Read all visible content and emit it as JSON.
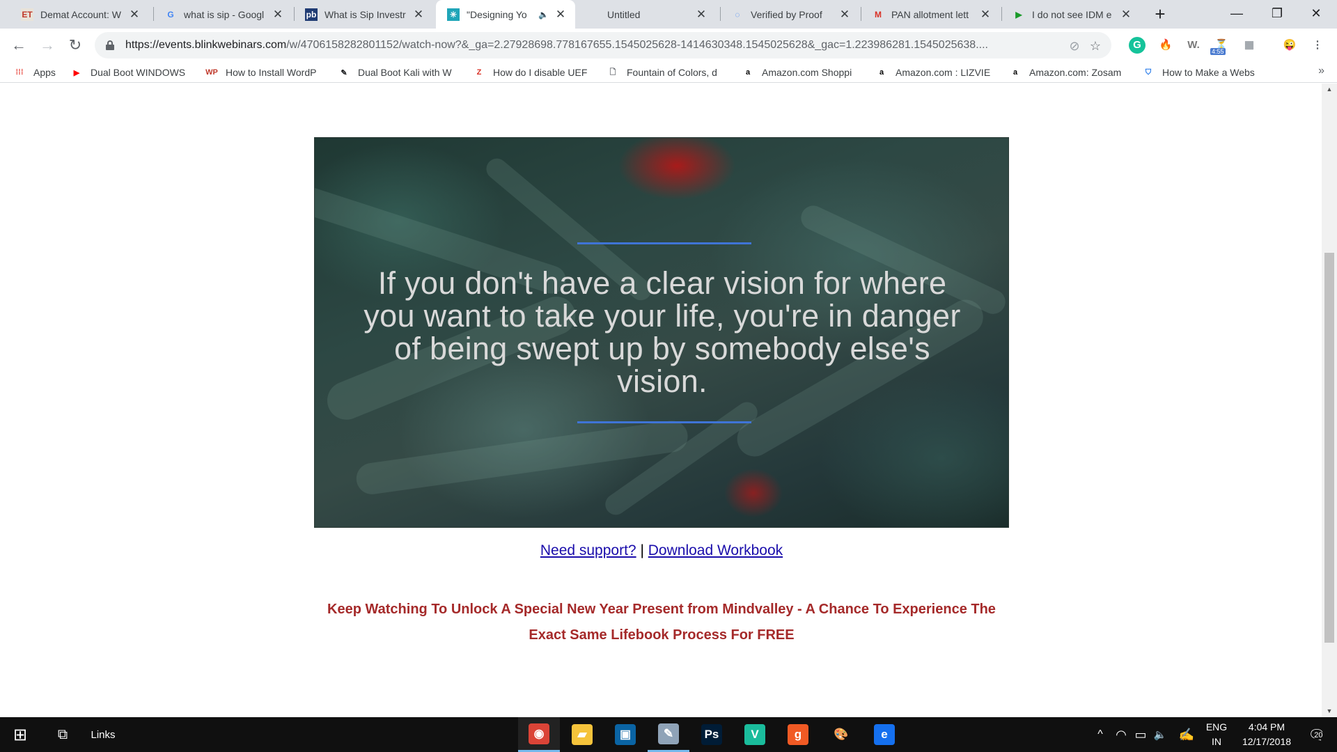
{
  "browser": {
    "tabs": [
      {
        "title": "Demat Account: W",
        "favicon": "ET",
        "favicon_color": "#c0392b",
        "favicon_bg": "#e8e3d9",
        "icon": "et-favicon-icon"
      },
      {
        "title": "what is sip - Googl",
        "favicon": "G",
        "favicon_color": "#4285f4",
        "favicon_bg": "transparent",
        "icon": "google-favicon-icon"
      },
      {
        "title": "What is Sip Investr",
        "favicon": "pb",
        "favicon_color": "#ffffff",
        "favicon_bg": "#1f3b73",
        "icon": "pb-favicon-icon"
      },
      {
        "title": "\"Designing Yo",
        "favicon": "✳",
        "favicon_color": "#ffffff",
        "favicon_bg": "#1fa5b8",
        "icon": "blinkwebinars-favicon-icon",
        "active": true,
        "audio": true
      },
      {
        "title": "Untitled",
        "favicon": "",
        "favicon_color": "#5f6368",
        "favicon_bg": "transparent",
        "icon": "blank-favicon-icon"
      },
      {
        "title": "Verified by Proof",
        "favicon": "◌",
        "favicon_color": "#3b82f6",
        "favicon_bg": "transparent",
        "icon": "proof-favicon-icon"
      },
      {
        "title": "PAN allotment lett",
        "favicon": "M",
        "favicon_color": "#d93025",
        "favicon_bg": "transparent",
        "icon": "gmail-favicon-icon"
      },
      {
        "title": "I do not see IDM e",
        "favicon": "▶",
        "favicon_color": "#1a9a2a",
        "favicon_bg": "transparent",
        "icon": "idm-favicon-icon"
      }
    ],
    "new_tab": "+",
    "window_controls": {
      "minimize": "—",
      "restore": "❐",
      "close": "✕"
    },
    "nav": {
      "back": "←",
      "forward": "→",
      "reload": "↻"
    },
    "url": {
      "host": "https://events.blinkwebinars.com",
      "rest": "/w/4706158282801152/watch-now?&_ga=2.27928698.778167655.1545025628-1414630348.1545025628&_gac=1.223986281.1545025638...."
    },
    "omnibox_icons": {
      "blocked": "⊘",
      "star": "☆"
    },
    "extensions": [
      {
        "glyph": "G",
        "color": "#ffffff",
        "bg": "#15c39a",
        "name": "grammarly-extension-icon"
      },
      {
        "glyph": "🔥",
        "color": "#ff6d00",
        "bg": "transparent",
        "name": "fire-extension-icon"
      },
      {
        "glyph": "W.",
        "color": "#7a7a7a",
        "bg": "transparent",
        "name": "w-extension-icon"
      },
      {
        "glyph": "⏳",
        "color": "#5f6368",
        "bg": "transparent",
        "name": "timer-extension-icon",
        "badge": "4:55"
      },
      {
        "glyph": "▦",
        "color": "#9aa0a6",
        "bg": "transparent",
        "name": "translate-extension-icon"
      },
      {
        "glyph": "😜",
        "color": "#f5b400",
        "bg": "transparent",
        "name": "profile-avatar-icon"
      },
      {
        "glyph": "⋮",
        "color": "#5f6368",
        "bg": "transparent",
        "name": "menu-kebab-icon"
      }
    ],
    "bookmarks": [
      {
        "label": "Apps",
        "icon": "apps-grid-icon",
        "glyph": "⁞⁞⁞",
        "color": "#e8453c"
      },
      {
        "label": "Dual Boot WINDOWS",
        "icon": "youtube-icon",
        "glyph": "▶",
        "color": "#ff0000"
      },
      {
        "label": "How to Install WordP",
        "icon": "wp-icon",
        "glyph": "WP",
        "color": "#c0392b"
      },
      {
        "label": "Dual Boot Kali with W",
        "icon": "kali-icon",
        "glyph": "✎",
        "color": "#202124"
      },
      {
        "label": "How do I disable UEF",
        "icon": "avast-icon",
        "glyph": "Z",
        "color": "#d93025"
      },
      {
        "label": "Fountain of Colors, d",
        "icon": "page-icon",
        "glyph": "🗋",
        "color": "#5f6368"
      },
      {
        "label": "Amazon.com Shoppi",
        "icon": "amazon-icon",
        "glyph": "a",
        "color": "#000000"
      },
      {
        "label": "Amazon.com : LIZVIE",
        "icon": "amazon-icon",
        "glyph": "a",
        "color": "#000000"
      },
      {
        "label": "Amazon.com: Zosam",
        "icon": "amazon-icon",
        "glyph": "a",
        "color": "#000000"
      },
      {
        "label": "How to Make a Webs",
        "icon": "shield-icon",
        "glyph": "⛉",
        "color": "#1a73e8"
      }
    ],
    "bookmarks_more": "»"
  },
  "page": {
    "video_quote": "If you don't have a clear vision for where you want to take your life, you're in danger of being swept up by somebody else's vision.",
    "support_link": "Need support?",
    "separator": "|",
    "workbook_link": "Download Workbook",
    "promo_text": "Keep Watching To Unlock A Special New Year Present from Mindvalley - A Chance To Experience The Exact Same Lifebook Process For FREE"
  },
  "taskbar": {
    "start": "⊞",
    "task_view": "⧉",
    "links_label": "Links",
    "apps": [
      {
        "name": "chrome-app-icon",
        "glyph": "◉",
        "bg": "#db4437",
        "state": "active"
      },
      {
        "name": "file-explorer-app-icon",
        "glyph": "▰",
        "bg": "#f5c33b",
        "state": ""
      },
      {
        "name": "outlook-app-icon",
        "glyph": "▣",
        "bg": "#0a64a4",
        "state": ""
      },
      {
        "name": "notepad-app-icon",
        "glyph": "✎",
        "bg": "#8fa3b8",
        "state": "open"
      },
      {
        "name": "photoshop-app-icon",
        "glyph": "Ps",
        "bg": "#001c36",
        "state": ""
      },
      {
        "name": "vectr-app-icon",
        "glyph": "V",
        "bg": "#1abc9c",
        "state": ""
      },
      {
        "name": "g-app-icon",
        "glyph": "g",
        "bg": "#f15a24",
        "state": ""
      },
      {
        "name": "paint-app-icon",
        "glyph": "🎨",
        "bg": "transparent",
        "state": ""
      },
      {
        "name": "edge-app-icon",
        "glyph": "e",
        "bg": "#1570ef",
        "state": ""
      }
    ],
    "tray": {
      "chevron": "^",
      "wifi": "◠",
      "battery": "▭",
      "volume": "🔈",
      "pen": "✍",
      "lang_top": "ENG",
      "lang_bottom": "IN",
      "time": "4:04 PM",
      "date": "12/17/2018",
      "notifications": "20"
    }
  }
}
